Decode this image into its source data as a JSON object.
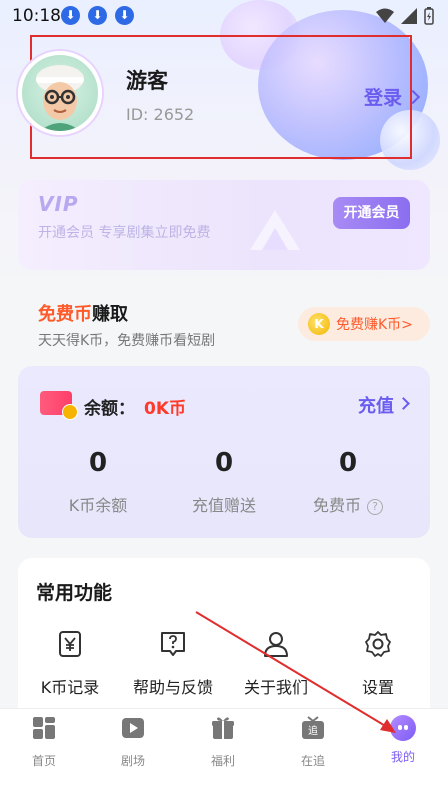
{
  "status_bar": {
    "time": "10:18"
  },
  "profile": {
    "name": "游客",
    "id_text": "ID: 2652",
    "login_label": "登录"
  },
  "vip": {
    "logo": "VIP",
    "desc": "开通会员  专享剧集立即免费",
    "button": "开通会员"
  },
  "free_coin": {
    "title_highlight": "免费币",
    "title_rest": "赚取",
    "desc": "天天得K币，免费赚币看短剧",
    "button": "免费赚K币>",
    "coin_letter": "K"
  },
  "balance": {
    "label": "余额：",
    "value": "0K币",
    "recharge_label": "充值",
    "stats": [
      {
        "value": "0",
        "label": "K币余额"
      },
      {
        "value": "0",
        "label": "充值赠送"
      },
      {
        "value": "0",
        "label": "免费币"
      }
    ],
    "help_symbol": "?"
  },
  "functions": {
    "title": "常用功能",
    "items": [
      {
        "label": "K币记录",
        "icon": "yen-record-icon"
      },
      {
        "label": "帮助与反馈",
        "icon": "help-feedback-icon"
      },
      {
        "label": "关于我们",
        "icon": "user-outline-icon"
      },
      {
        "label": "设置",
        "icon": "gear-icon"
      }
    ]
  },
  "bottom_nav": {
    "items": [
      {
        "label": "首页",
        "icon": "home-grid-icon"
      },
      {
        "label": "剧场",
        "icon": "play-icon"
      },
      {
        "label": "福利",
        "icon": "gift-icon"
      },
      {
        "label": "在追",
        "icon": "tv-follow-icon"
      },
      {
        "label": "我的",
        "icon": "me-icon",
        "active": true
      }
    ],
    "follow_glyph": "追"
  },
  "colors": {
    "accent": "#6b5cf0",
    "highlight_red": "#ff3a2a",
    "orange": "#ff5a2a",
    "annotation_red": "#e02d2d"
  }
}
